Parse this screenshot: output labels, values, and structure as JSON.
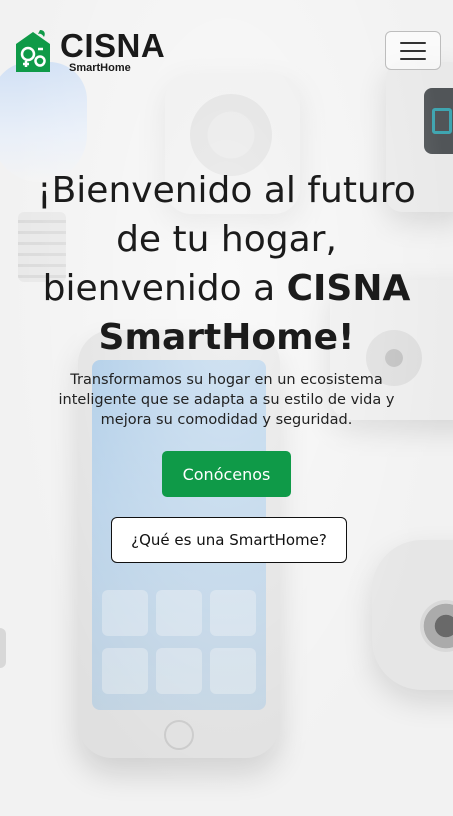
{
  "brand": {
    "name": "CISNA",
    "subname": "SmartHome",
    "logo_icon": "smart-home-logo-icon",
    "color": "#0f9a48"
  },
  "navbar": {
    "menu_icon": "hamburger-menu-icon"
  },
  "hero": {
    "title_line1": "¡Bienvenido al futuro",
    "title_line2": "de tu hogar,",
    "title_line3_prefix": "bienvenido a ",
    "title_line3_brand": "CISNA",
    "title_line4": "SmartHome!",
    "subtitle": "Transformamos su hogar en un ecosistema inteligente que se adapta a su estilo de vida y mejora su comodidad y seguridad."
  },
  "actions": {
    "primary_label": "Conócenos",
    "secondary_label": "¿Qué es una SmartHome?"
  },
  "colors": {
    "primary": "#0f9a48",
    "text": "#1b1b1b",
    "background": "#f2f2f2"
  }
}
